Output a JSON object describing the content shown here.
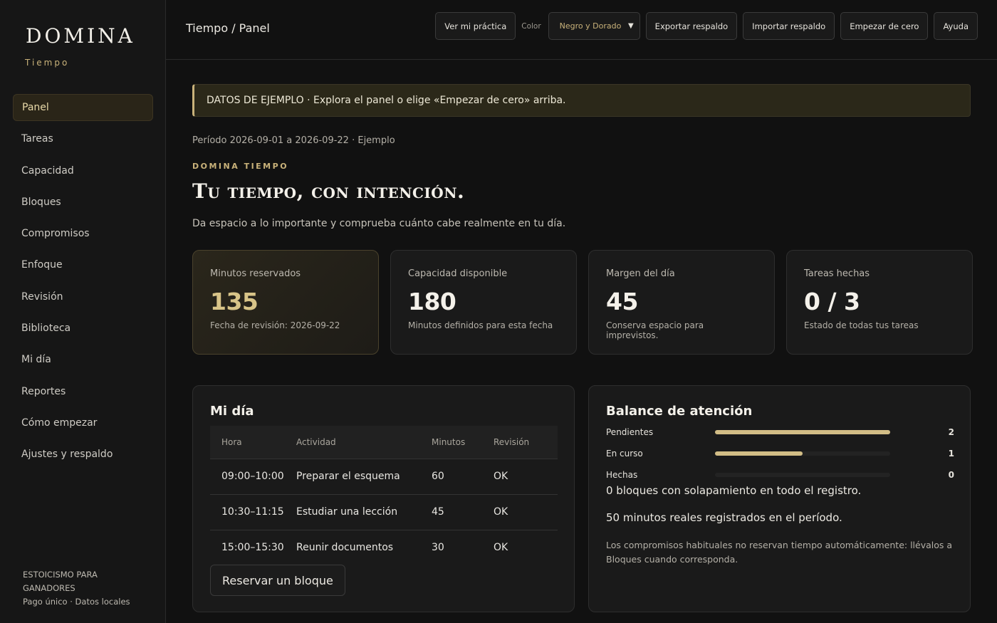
{
  "sidebar": {
    "brand": "DOMINA",
    "brand_sub": "Tiempo",
    "items": [
      {
        "label": "Panel",
        "active": true
      },
      {
        "label": "Tareas"
      },
      {
        "label": "Capacidad"
      },
      {
        "label": "Bloques"
      },
      {
        "label": "Compromisos"
      },
      {
        "label": "Enfoque"
      },
      {
        "label": "Revisión"
      },
      {
        "label": "Biblioteca"
      },
      {
        "label": "Mi día"
      },
      {
        "label": "Reportes"
      },
      {
        "label": "Cómo empezar"
      },
      {
        "label": "Ajustes y respaldo"
      }
    ],
    "footer_line1": "ESTOICISMO PARA GANADORES",
    "footer_line2": "Pago único · Datos locales"
  },
  "topbar": {
    "breadcrumb": "Tiempo / Panel",
    "view_practice": "Ver mi práctica",
    "color_label": "Color",
    "color_selected": "Negro y Dorado",
    "export": "Exportar respaldo",
    "import": "Importar respaldo",
    "reset": "Empezar de cero",
    "help": "Ayuda"
  },
  "banner": "DATOS DE EJEMPLO · Explora el panel o elige «Empezar de cero» arriba.",
  "period": "Período 2026-09-01 a 2026-09-22 · Ejemplo",
  "kicker": "DOMINA TIEMPO",
  "headline": "Tu tiempo, con intención.",
  "lead": "Da espacio a lo importante y comprueba cuánto cabe realmente en tu día.",
  "stats": [
    {
      "label": "Minutos reservados",
      "value": "135",
      "note": "Fecha de revisión: 2026-09-22"
    },
    {
      "label": "Capacidad disponible",
      "value": "180",
      "note": "Minutos definidos para esta fecha"
    },
    {
      "label": "Margen del día",
      "value": "45",
      "note": "Conserva espacio para imprevistos."
    },
    {
      "label": "Tareas hechas",
      "value": "0 / 3",
      "note": "Estado de todas tus tareas"
    }
  ],
  "my_day": {
    "title": "Mi día",
    "columns": [
      "Hora",
      "Actividad",
      "Minutos",
      "Revisión"
    ],
    "rows": [
      [
        "09:00–10:00",
        "Preparar el esquema",
        "60",
        "OK"
      ],
      [
        "10:30–11:15",
        "Estudiar una lección",
        "45",
        "OK"
      ],
      [
        "15:00–15:30",
        "Reunir documentos",
        "30",
        "OK"
      ]
    ],
    "reserve_button": "Reservar un bloque"
  },
  "balance": {
    "title": "Balance de atención",
    "rows": [
      {
        "label": "Pendientes",
        "count": "2",
        "fraction": 1.0
      },
      {
        "label": "En curso",
        "count": "1",
        "fraction": 0.5
      },
      {
        "label": "Hechas",
        "count": "0",
        "fraction": 0
      }
    ],
    "overlap_text": "0 bloques con solapamiento en todo el registro.",
    "minutes_text": "50 minutos reales registrados en el período.",
    "note": "Los compromisos habituales no reservan tiempo automáticamente: llévalos a Bloques cuando corresponda."
  },
  "colors": {
    "accent": "#c9b27a",
    "background": "#111111",
    "panel": "#1a1a1a"
  }
}
